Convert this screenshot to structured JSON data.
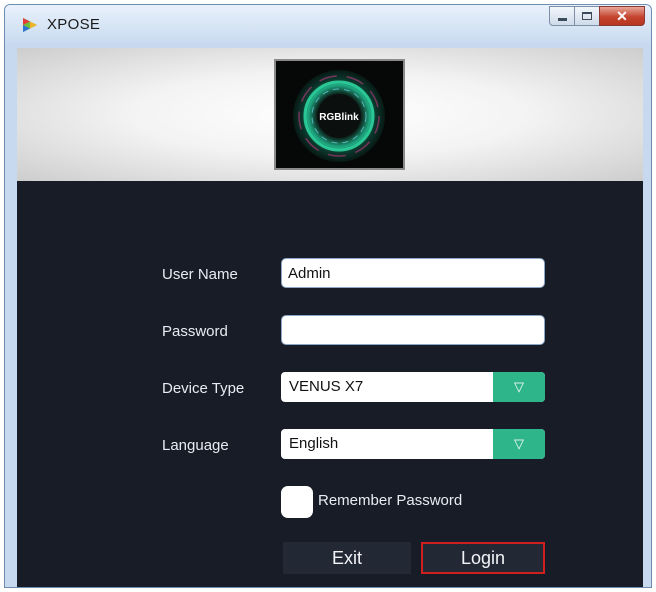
{
  "window": {
    "title": "XPOSE",
    "controls": [
      "minimize-icon",
      "maximize-icon",
      "close-icon"
    ]
  },
  "banner": {
    "logo_text": "RGBlink"
  },
  "form": {
    "username": {
      "label": "User Name",
      "value": "Admin"
    },
    "password": {
      "label": "Password",
      "value": ""
    },
    "device_type": {
      "label": "Device Type",
      "value": "VENUS X7"
    },
    "language": {
      "label": "Language",
      "value": "English"
    },
    "dropdown_icon": "▽",
    "remember_password": {
      "label": "Remember Password",
      "checked": false
    }
  },
  "buttons": {
    "exit": "Exit",
    "login": "Login"
  },
  "colors": {
    "form_background": "#181c26",
    "dropdown_accent": "#2fb58a",
    "highlight_border": "#d01f1f"
  }
}
